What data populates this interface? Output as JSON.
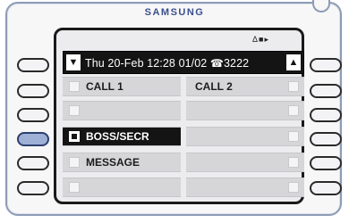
{
  "device": {
    "brand": "SAMSUNG"
  },
  "display": {
    "status_icons": "Δ■▸",
    "header": {
      "left_arrow": "▼",
      "datetime": "Thu 20-Feb 12:28",
      "page": "01/02",
      "phone_icon": "☎",
      "extension": "3222",
      "right_arrow": "▲"
    },
    "keys": [
      {
        "left": "CALL 1",
        "right": "CALL 2"
      },
      {
        "left": "",
        "right": ""
      },
      {
        "left": "BOSS/SECR",
        "right": ""
      },
      {
        "left": "MESSAGE",
        "right": ""
      },
      {
        "left": "",
        "right": ""
      }
    ]
  },
  "colors": {
    "screen_bg": "#ececee",
    "key_bg": "#d6d6d9",
    "selected_bg": "#141414",
    "active_soft_key": "#9fb0d6",
    "brand": "#3a4f8c"
  }
}
